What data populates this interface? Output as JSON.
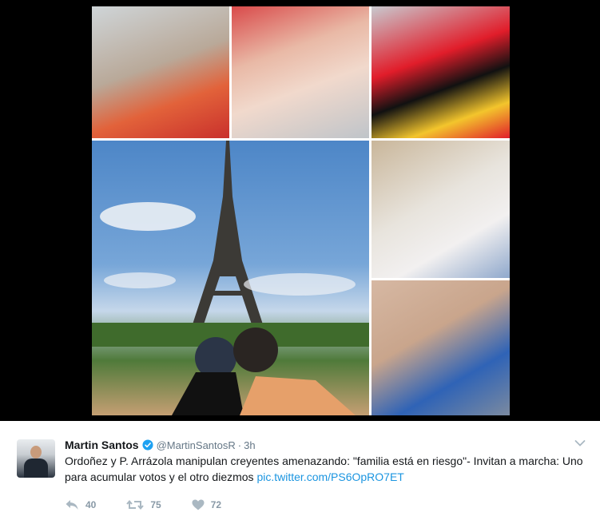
{
  "media": {
    "photos": [
      {
        "name": "couple-orange-selfie"
      },
      {
        "name": "couple-selfie-carnival"
      },
      {
        "name": "couple-ship-sunglasses"
      },
      {
        "name": "couple-kiss-eiffel-tower"
      },
      {
        "name": "man-smiling-closeup"
      },
      {
        "name": "couple-standing-brick-wall"
      }
    ]
  },
  "tweet": {
    "author_name": "Martin Santos",
    "handle": "@MartinSantosR",
    "separator": "·",
    "time": "3h",
    "text_main": "Ordoñez y P. Arrázola manipulan creyentes amenazando: \"familia está en riesgo\"- Invitan a marcha: Uno para acumular votos y el otro diezmos ",
    "text_link": "pic.twitter.com/PS6OpRO7ET",
    "reply_count": "40",
    "retweet_count": "75",
    "like_count": "72"
  },
  "icons": {
    "verified": "verified-badge-icon",
    "caret": "chevron-down-icon",
    "reply": "reply-icon",
    "retweet": "retweet-icon",
    "like": "heart-icon"
  },
  "colors": {
    "link": "#1b95e0",
    "verified": "#1da1f2",
    "action_icon": "#aab8c2",
    "text": "#14171a",
    "secondary": "#657786"
  }
}
